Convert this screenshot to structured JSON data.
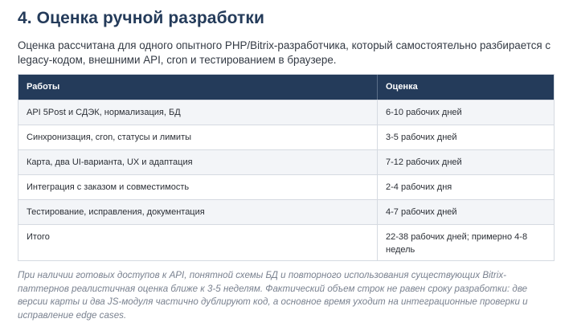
{
  "section": {
    "title": "4. Оценка ручной разработки",
    "intro": "Оценка рассчитана для одного опытного PHP/Bitrix-разработчика, который самостоятельно разбирается с legacy-кодом, внешними API, cron и тестированием в браузере."
  },
  "table": {
    "headers": [
      "Работы",
      "Оценка"
    ],
    "rows": [
      [
        "API 5Post и СДЭК, нормализация, БД",
        "6-10 рабочих дней"
      ],
      [
        "Синхронизация, cron, статусы и лимиты",
        "3-5 рабочих дней"
      ],
      [
        "Карта, два UI-варианта, UX и адаптация",
        "7-12 рабочих дней"
      ],
      [
        "Интеграция с заказом и совместимость",
        "2-4 рабочих дня"
      ],
      [
        "Тестирование, исправления, документация",
        "4-7 рабочих дней"
      ],
      [
        "Итого",
        "22-38 рабочих дней; примерно 4-8 недель"
      ]
    ]
  },
  "footnote": "При наличии готовых доступов к API, понятной схемы БД и повторного использования существующих Bitrix-паттернов реалистичная оценка ближе к 3-5 неделям. Фактический объем строк не равен сроку разработки: две версии карты и два JS-модуля частично дублируют код, а основное время уходит на интеграционные проверки и исправление edge cases.",
  "colors": {
    "header_bg": "#243b5a",
    "title": "#243b5a",
    "alt_row": "#f3f5f8",
    "border": "#d5dae1",
    "footnote": "#7a8290"
  }
}
